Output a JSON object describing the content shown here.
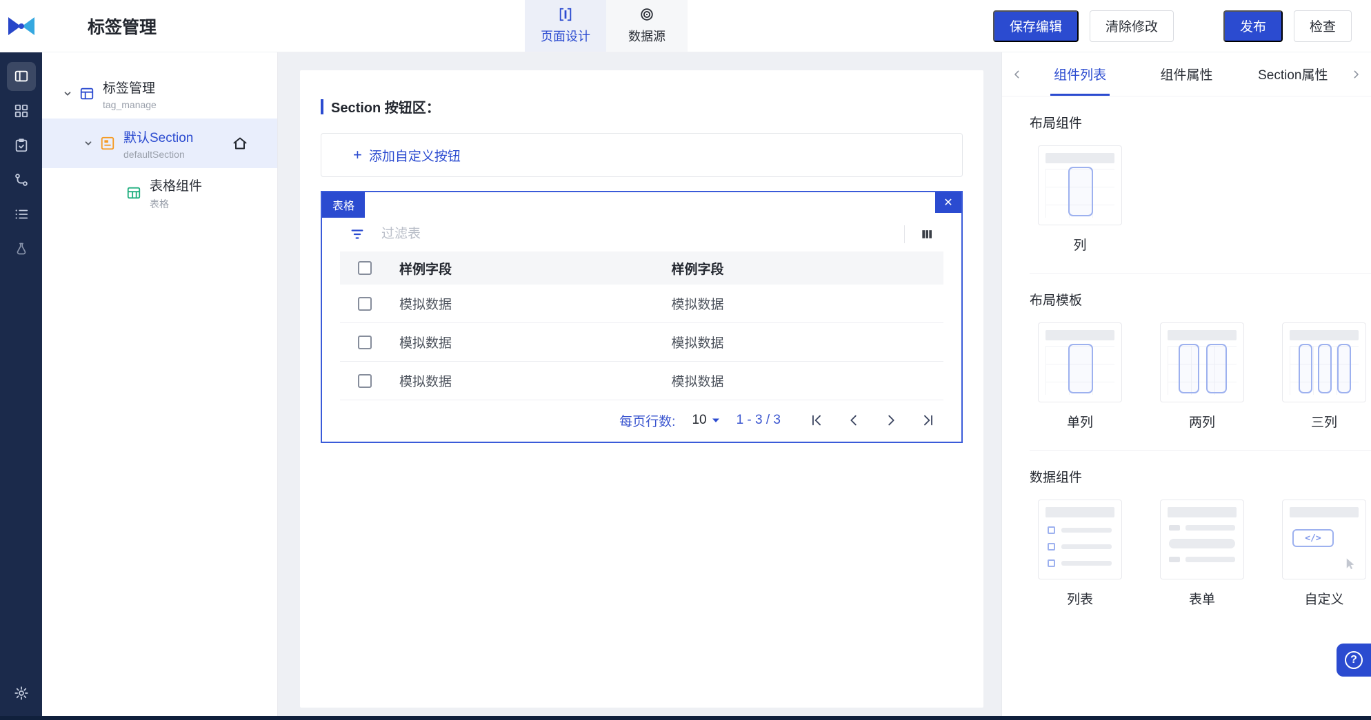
{
  "header": {
    "title": "标签管理",
    "tabs": [
      {
        "label": "页面设计",
        "active": true
      },
      {
        "label": "数据源",
        "active": false
      }
    ],
    "buttons": {
      "save": "保存编辑",
      "clear": "清除修改",
      "publish": "发布",
      "check": "检查"
    }
  },
  "rail_icons": [
    "page-design-icon",
    "components-icon",
    "checklist-icon",
    "flow-icon",
    "list-icon",
    "lab-icon",
    "settings-gear-icon"
  ],
  "tree": {
    "items": [
      {
        "label": "标签管理",
        "sub": "tag_manage"
      },
      {
        "label": "默认Section",
        "sub": "defaultSection",
        "selected": true
      },
      {
        "label": "表格组件",
        "sub": "表格"
      }
    ]
  },
  "canvas": {
    "section_title": "Section 按钮区：",
    "add_button": {
      "plus": "+",
      "label": "添加自定义按钮"
    },
    "component": {
      "chip": "表格",
      "close": "✕"
    },
    "table": {
      "filter_placeholder": "过滤表",
      "headers": [
        "样例字段",
        "样例字段"
      ],
      "rows": [
        [
          "模拟数据",
          "模拟数据"
        ],
        [
          "模拟数据",
          "模拟数据"
        ],
        [
          "模拟数据",
          "模拟数据"
        ]
      ],
      "pagination": {
        "rows_per_page_label": "每页行数:",
        "rows_per_page": "10",
        "range": "1 - 3 / 3"
      }
    }
  },
  "right_panel": {
    "nav": {
      "tabs": [
        "组件列表",
        "组件属性",
        "Section属性"
      ],
      "active": "组件列表"
    },
    "sections": [
      {
        "title": "布局组件",
        "cards": [
          {
            "label": "列"
          }
        ]
      },
      {
        "title": "布局模板",
        "cards": [
          {
            "label": "单列"
          },
          {
            "label": "两列"
          },
          {
            "label": "三列"
          }
        ]
      },
      {
        "title": "数据组件",
        "cards": [
          {
            "label": "列表"
          },
          {
            "label": "表单"
          },
          {
            "label": "自定义",
            "code": "</>"
          }
        ]
      }
    ]
  },
  "help": {
    "glyph": "?"
  },
  "colors": {
    "accent": "#2b4bd0",
    "navy": "#1b2a4b",
    "selected_row": "#e9eefc"
  }
}
